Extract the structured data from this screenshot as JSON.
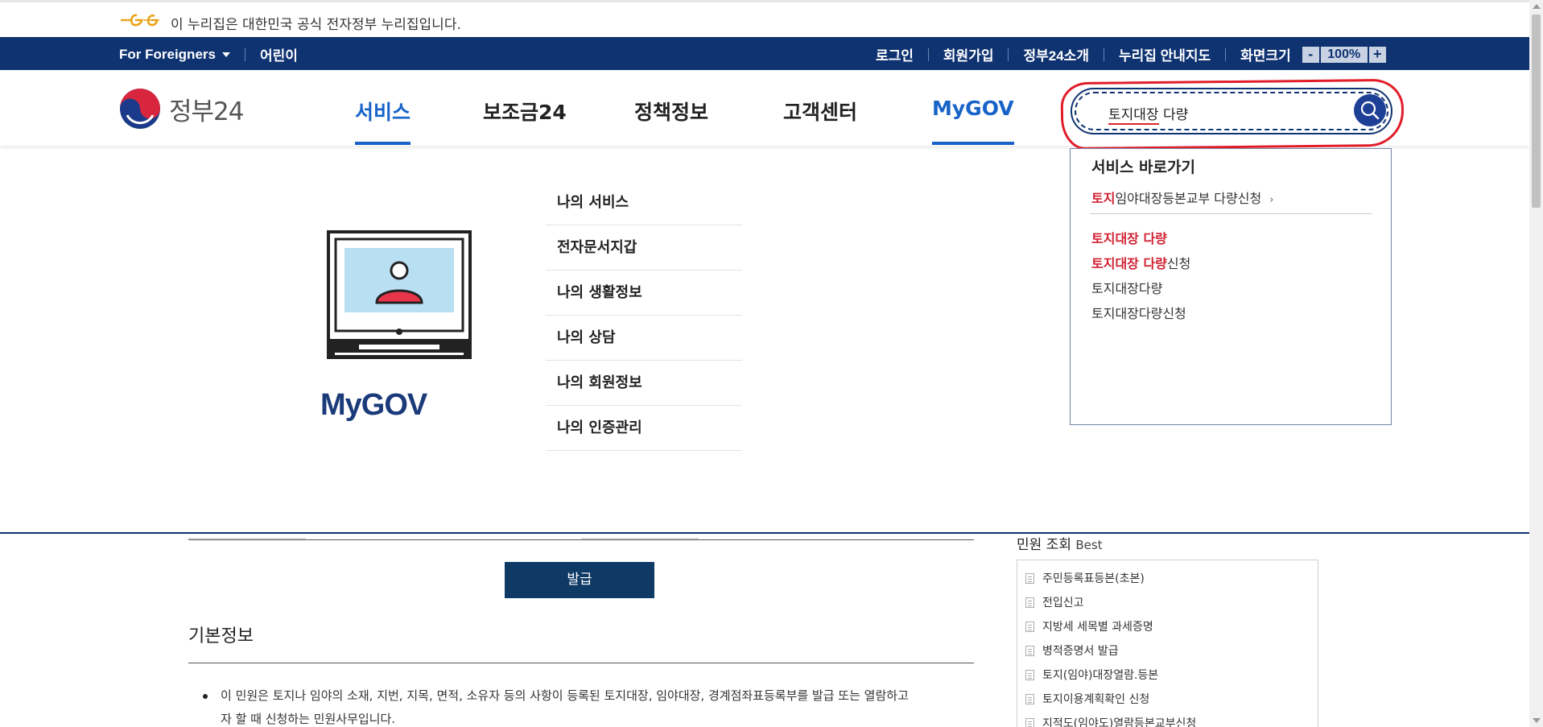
{
  "gov_banner": {
    "text": "이 누리집은 대한민국 공식 전자정부 누리집입니다."
  },
  "util_nav": {
    "foreigners": "For Foreigners",
    "kids": "어린이",
    "login": "로그인",
    "signup": "회원가입",
    "intro": "정부24소개",
    "sitemap": "누리집 안내지도",
    "screen_size": "화면크기",
    "zoom_minus": "-",
    "zoom_value": "100%",
    "zoom_plus": "+"
  },
  "header": {
    "logo_text": "정부24",
    "menus": [
      {
        "label": "서비스",
        "active": true
      },
      {
        "label": "보조금24",
        "active": false
      },
      {
        "label": "정책정보",
        "active": false
      },
      {
        "label": "고객센터",
        "active": false
      },
      {
        "label": "MyGOV",
        "active": true
      }
    ]
  },
  "search": {
    "value_underlined": "토지대장",
    "value_rest": " 다량"
  },
  "mygov_panel": {
    "title": "MyGOV",
    "submenu": [
      "나의 서비스",
      "전자문서지갑",
      "나의 생활정보",
      "나의 상담",
      "나의 회원정보",
      "나의 인증관리"
    ]
  },
  "suggest": {
    "heading": "서비스 바로가기",
    "shortcut_hl": "토지",
    "shortcut_rest": "임야대장등본교부 다량신청",
    "shortcut_chevron": "›",
    "items": [
      {
        "hl": "토지대장 다량",
        "rest": ""
      },
      {
        "hl": "토지대장 다량",
        "rest": "신청"
      },
      {
        "hl": "",
        "rest": "토지대장다량"
      },
      {
        "hl": "",
        "rest": "토지대장다량신청"
      }
    ]
  },
  "content": {
    "issue_button": "발급",
    "basic_info": "기본정보",
    "desc_line1": "이 민원은 토지나 임야의 소재, 지번, 지목, 면적, 소유자 등의 사항이 등록된 토지대장, 임야대장, 경계점좌표등록부를 발급 또는 열람하고",
    "desc_line2": "자 할 때 신청하는 민원사무입니다."
  },
  "best": {
    "title": "민원 조회",
    "title_small": "Best",
    "items": [
      "주민등록표등본(초본)",
      "전입신고",
      "지방세 세목별 과세증명",
      "병적증명서 발급",
      "토지(임야)대장열람.등본",
      "토지이용계획확인 신청",
      "지적도(임야도)열람등본교부신청"
    ]
  },
  "colors": {
    "navy": "#0f3371",
    "accent_blue": "#1763c9",
    "highlight_red": "#d12132",
    "annotation_red": "#e11d2a"
  }
}
